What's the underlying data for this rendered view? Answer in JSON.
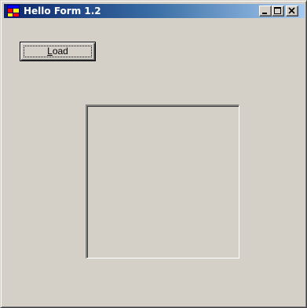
{
  "window": {
    "title": "Hello Form 1.2"
  },
  "titlebar": {
    "icon": "app-form-icon",
    "buttons": {
      "minimize_icon": "minimize-icon",
      "maximize_icon": "maximize-icon",
      "close_icon": "close-icon"
    },
    "gradient_start": "#0a246a",
    "gradient_end": "#a6caf0"
  },
  "form": {
    "load_button": {
      "mnemonic": "L",
      "rest": "oad"
    },
    "picture_box": {
      "image": ""
    },
    "background_color": "#d4d0c8"
  }
}
